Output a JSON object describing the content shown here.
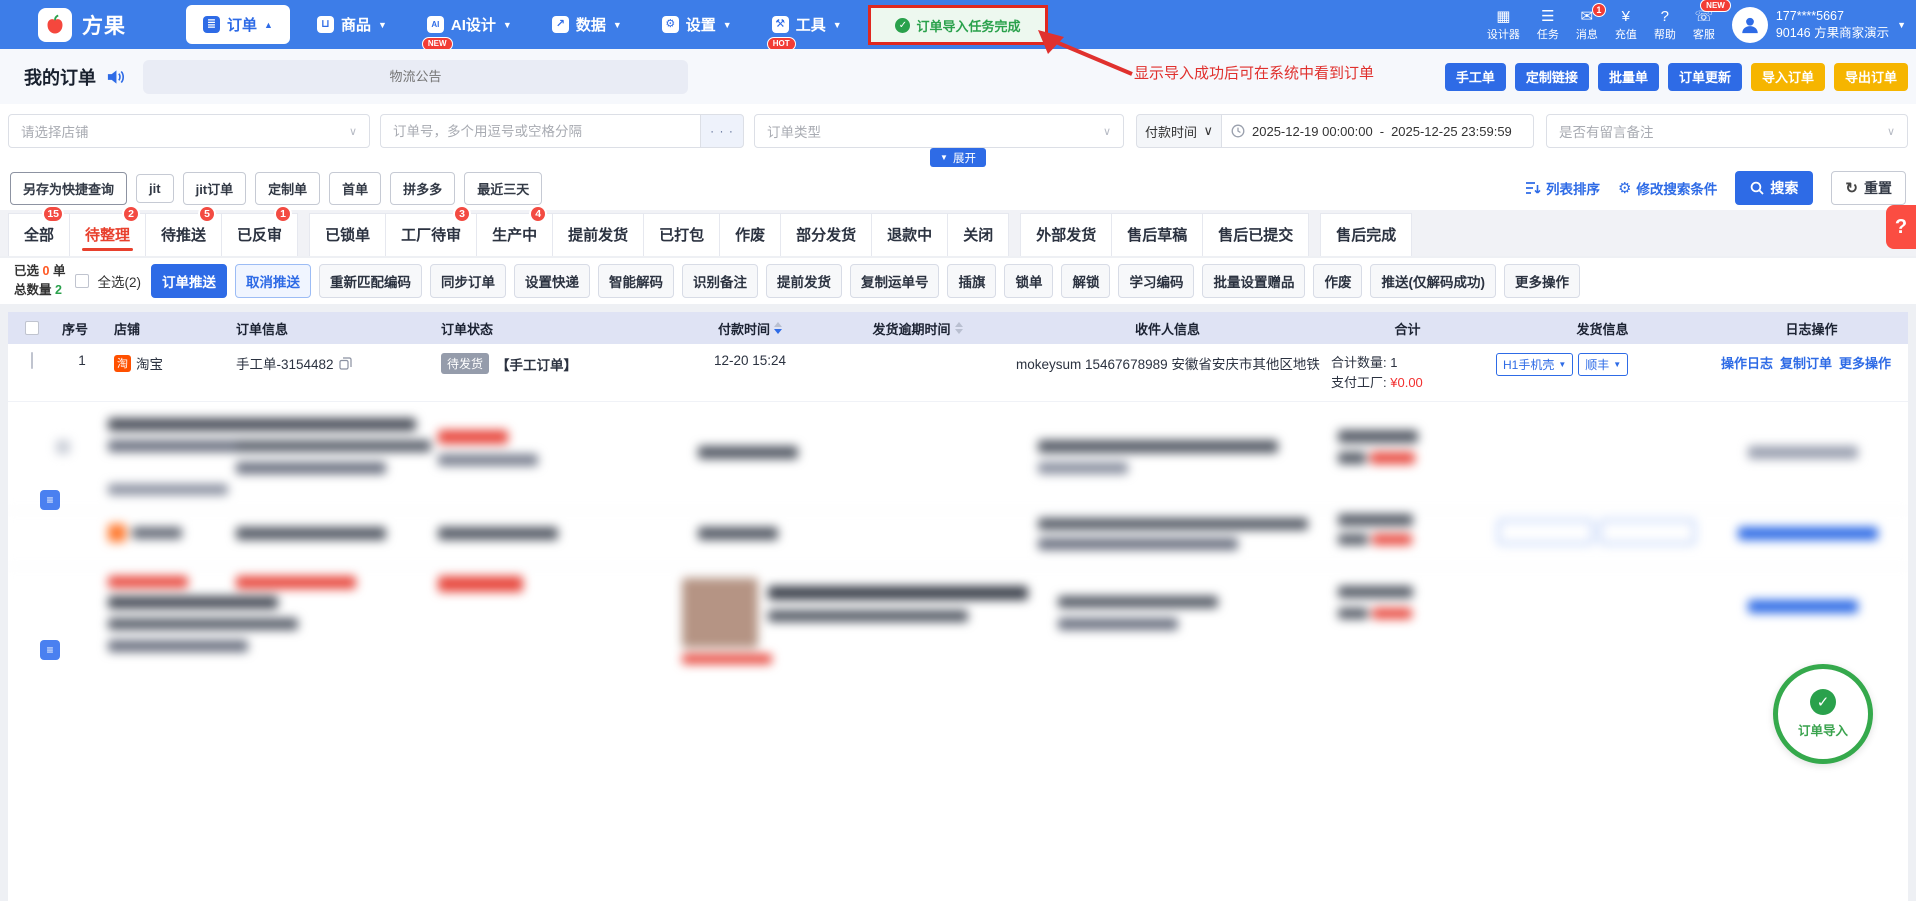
{
  "glyphs": {
    "caret_up": "▲",
    "caret_down": "▼",
    "caret_select": "∨",
    "check": "✓",
    "question": "?",
    "yuan": "¥",
    "refresh": "↻",
    "dots": "· · ·",
    "sort_list": "≡↓",
    "gear": "⚙",
    "headset": "☏",
    "designer": "▦",
    "tasks": "☰",
    "mail": "✉",
    "taobao": "淘",
    "menu_order": "≣",
    "menu_goods": "⊔",
    "menu_ai": "AI",
    "menu_data": "↗",
    "menu_tools": "⚒",
    "note": "≡"
  },
  "navbar": {
    "brand": "方果",
    "menu": [
      {
        "label": "订单"
      },
      {
        "label": "商品"
      },
      {
        "label": "AI设计",
        "badge": "NEW"
      },
      {
        "label": "数据"
      },
      {
        "label": "设置"
      },
      {
        "label": "工具",
        "badge": "HOT"
      }
    ],
    "toast": {
      "text": "订单导入任务完成"
    },
    "icons": [
      {
        "label": "设计器"
      },
      {
        "label": "任务"
      },
      {
        "label": "消息",
        "badge": "1"
      },
      {
        "label": "充值"
      },
      {
        "label": "帮助"
      },
      {
        "label": "客服",
        "badge": "NEW"
      }
    ],
    "user": {
      "phone": "177****5667",
      "account": "90146 方果商家演示"
    }
  },
  "announce": {
    "title": "我的订单",
    "placeholder": "物流公告",
    "annotation": "显示导入成功后可在系统中看到订单",
    "buttons": [
      "手工单",
      "定制链接",
      "批量单",
      "订单更新",
      "导入订单",
      "导出订单"
    ]
  },
  "filters": {
    "shop_placeholder": "请选择店铺",
    "order_no_placeholder": "订单号，多个用逗号或空格分隔",
    "order_type": "订单类型",
    "pay_time": "付款时间",
    "date_start": "2025-12-19 00:00:00",
    "date_sep": "-",
    "date_end": "2025-12-25 23:59:59",
    "remark": "是否有留言备注",
    "expand": "展开"
  },
  "quick": {
    "save": "另存为快捷查询",
    "items": [
      "jit",
      "jit订单",
      "定制单",
      "首单",
      "拼多多",
      "最近三天"
    ],
    "sort": "列表排序",
    "modify": "修改搜索条件",
    "search": "搜索",
    "reset": "重置"
  },
  "tabs": [
    {
      "label": "全部",
      "badge": "15"
    },
    {
      "label": "待整理",
      "badge": "2"
    },
    {
      "label": "待推送",
      "badge": "5"
    },
    {
      "label": "已反审",
      "badge": "1"
    },
    {
      "label": "已锁单"
    },
    {
      "label": "工厂待审",
      "badge": "3"
    },
    {
      "label": "生产中",
      "badge": "4"
    },
    {
      "label": "提前发货"
    },
    {
      "label": "已打包"
    },
    {
      "label": "作废"
    },
    {
      "label": "部分发货"
    },
    {
      "label": "退款中"
    },
    {
      "label": "关闭"
    },
    {
      "label": "外部发货"
    },
    {
      "label": "售后草稿"
    },
    {
      "label": "售后已提交"
    },
    {
      "label": "售后完成"
    }
  ],
  "action": {
    "sel_label1": "已选",
    "sel_num": "0",
    "sel_label2": "单",
    "total_label": "总数量",
    "total_num": "2",
    "select_all": "全选(2)",
    "buttons": [
      "订单推送",
      "取消推送",
      "重新匹配编码",
      "同步订单",
      "设置快递",
      "智能解码",
      "识别备注",
      "提前发货",
      "复制运单号",
      "插旗",
      "锁单",
      "解锁",
      "学习编码",
      "批量设置赠品",
      "作废",
      "推送(仅解码成功)",
      "更多操作"
    ]
  },
  "table": {
    "headers": [
      "序号",
      "店铺",
      "订单信息",
      "订单状态",
      "付款时间",
      "发货逾期时间",
      "收件人信息",
      "合计",
      "发货信息",
      "日志操作"
    ],
    "row1": {
      "index": "1",
      "shop": "淘宝",
      "order_no": "手工单-3154482",
      "status_badge": "待发货",
      "status_text": "【手工订单】",
      "pay_time": "12-20 15:24",
      "receiver": "mokeysum 15467678989 安徽省安庆市其他区地铁",
      "total_line1": "合计数量: 1",
      "total_label2": "支付工厂:",
      "total_amount": "¥0.00",
      "ship1": "H1手机壳",
      "ship2": "顺丰",
      "log_links": [
        "操作日志",
        "复制订单",
        "更多操作"
      ]
    }
  },
  "floating": {
    "label": "订单导入"
  },
  "help": {
    "label": "?"
  }
}
